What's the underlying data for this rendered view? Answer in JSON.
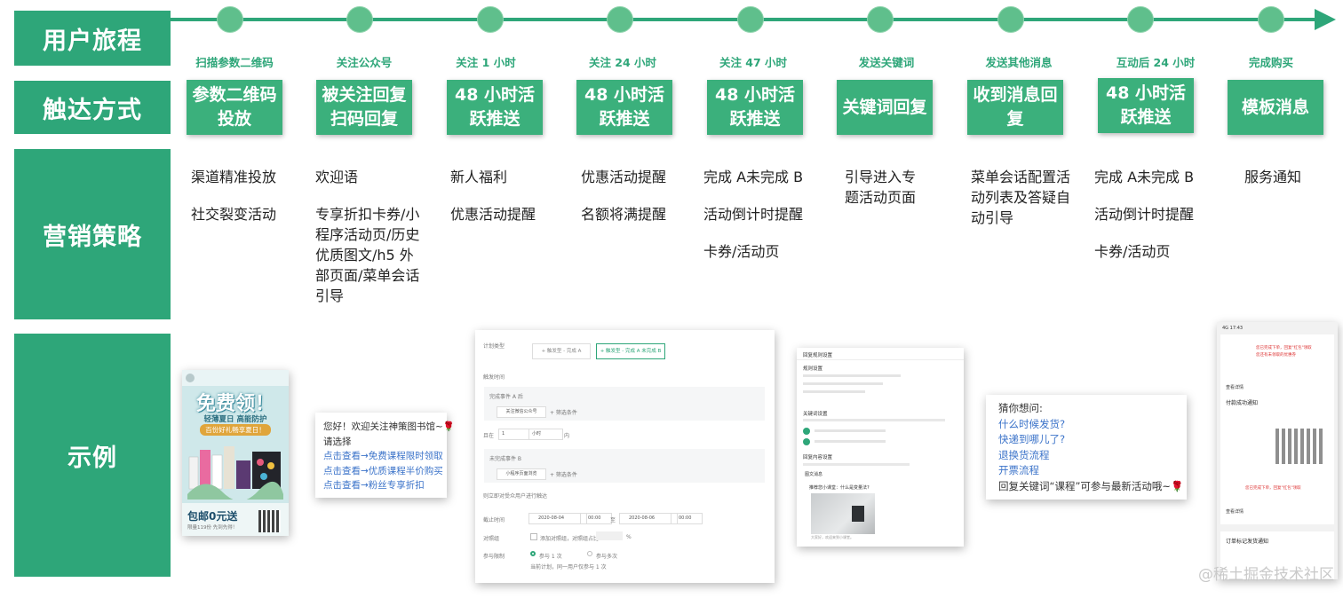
{
  "row_headers": [
    "用户旅程",
    "触达方式",
    "营销策略",
    "示例"
  ],
  "stages": [
    "扫描参数二维码",
    "关注公众号",
    "关注 1 小时",
    "关注 24 小时",
    "关注 47 小时",
    "发送关键词",
    "发送其他消息",
    "互动后 24 小时",
    "完成购买"
  ],
  "touch": [
    [
      "参数二维码",
      "投放"
    ],
    [
      "被关注回复",
      "扫码回复"
    ],
    [
      "48 小时活",
      "跃推送"
    ],
    [
      "48 小时活",
      "跃推送"
    ],
    [
      "48 小时活",
      "跃推送"
    ],
    [
      "关键词回复",
      ""
    ],
    [
      "收到消息回",
      "复"
    ],
    [
      "48 小时活",
      "跃推送"
    ],
    [
      "模板消息",
      ""
    ]
  ],
  "strategy": [
    [
      "渠道精准投放",
      "社交裂变活动"
    ],
    [
      "欢迎语",
      "专享折扣卡券/小程序活动页/历史优质图文/h5 外部页面/菜单会话引导"
    ],
    [
      "新人福利",
      "优惠活动提醒"
    ],
    [
      "优惠活动提醒",
      "名额将满提醒"
    ],
    [
      "完成 A未完成 B",
      "活动倒计时提醒",
      "卡券/活动页"
    ],
    [
      "引导进入专题活动页面"
    ],
    [
      "菜单会话配置活动列表及答疑自动引导"
    ],
    [
      "完成 A未完成 B",
      "活动倒计时提醒",
      "卡券/活动页"
    ],
    [
      "服务通知"
    ]
  ],
  "examples": {
    "poster": {
      "headline": "免费领！",
      "subline": "轻薄夏日 高能防护",
      "banner": "百份好礼畅享夏日！",
      "bottom_main": "包邮0元送",
      "bottom_sub": "限量119份 先到先得！"
    },
    "welcome": {
      "lines": [
        "您好！欢迎关注神策图书馆~🌹",
        "请选择"
      ],
      "links": [
        "点击查看→免费课程限时领取",
        "点击查看→优质课程半价购买",
        "点击查看→粉丝专享折扣"
      ]
    },
    "form": {
      "plan_type_label": "计划类型",
      "plan_opt1": "+ 触发型 - 完成 A",
      "plan_opt2": "+ 触发型 - 完成 A 未完成 B",
      "trigger_time": "触发时间",
      "event_a": "完成事件 A 后",
      "event_a_value": "关注微信公众号",
      "filter": "+ 筛选条件",
      "within_label": "且在",
      "within_value": "1",
      "within_unit": "小时",
      "within_suffix": "内",
      "event_b": "未完成事件 B",
      "event_b_value": "小程序页面浏览",
      "group_label": "则立即对受众用户进行触达",
      "deadline_label": "截止时间",
      "date_start": "2020-08-04",
      "time_start": "00:00",
      "to": "至",
      "date_end": "2020-08-06",
      "time_end": "00:00",
      "control_label": "对照组",
      "control_text": "添加对照组，对照组占比",
      "control_pct": "%",
      "limit_label": "参与限制",
      "limit_opt1": "参与 1 次",
      "limit_opt2": "参与多次",
      "limit_note": "当前计划，同一用户仅参与 1 次"
    },
    "keyword": {
      "title": "回复规则设置",
      "s1": "规则设置",
      "s2": "关键词设置",
      "s3": "回复内容设置",
      "tag": "图文消息",
      "article": "推荐您小课堂：什么是变量法?",
      "caption": "大家好，欢迎来到小课堂。"
    },
    "suggest": {
      "title": "猜你想问:",
      "links": [
        "什么时候发货?",
        "快递到哪儿了?",
        "退换货流程",
        "开票流程"
      ],
      "footer": "回复关键词“课程”可参与最新活动哦~🌹"
    },
    "phone": {
      "status": "4G 17:43",
      "red1": "您已完成下单，回复\"红包\"领取",
      "red2": "您还有未领取的优惠券",
      "link1": "查看详情",
      "notice1": "付款成功通知",
      "red3": "您已完成下单，回复\"红包\"领取",
      "link2": "查看详情",
      "notice2": "订单标记发货通知"
    }
  },
  "watermark": "@稀土掘金技术社区"
}
